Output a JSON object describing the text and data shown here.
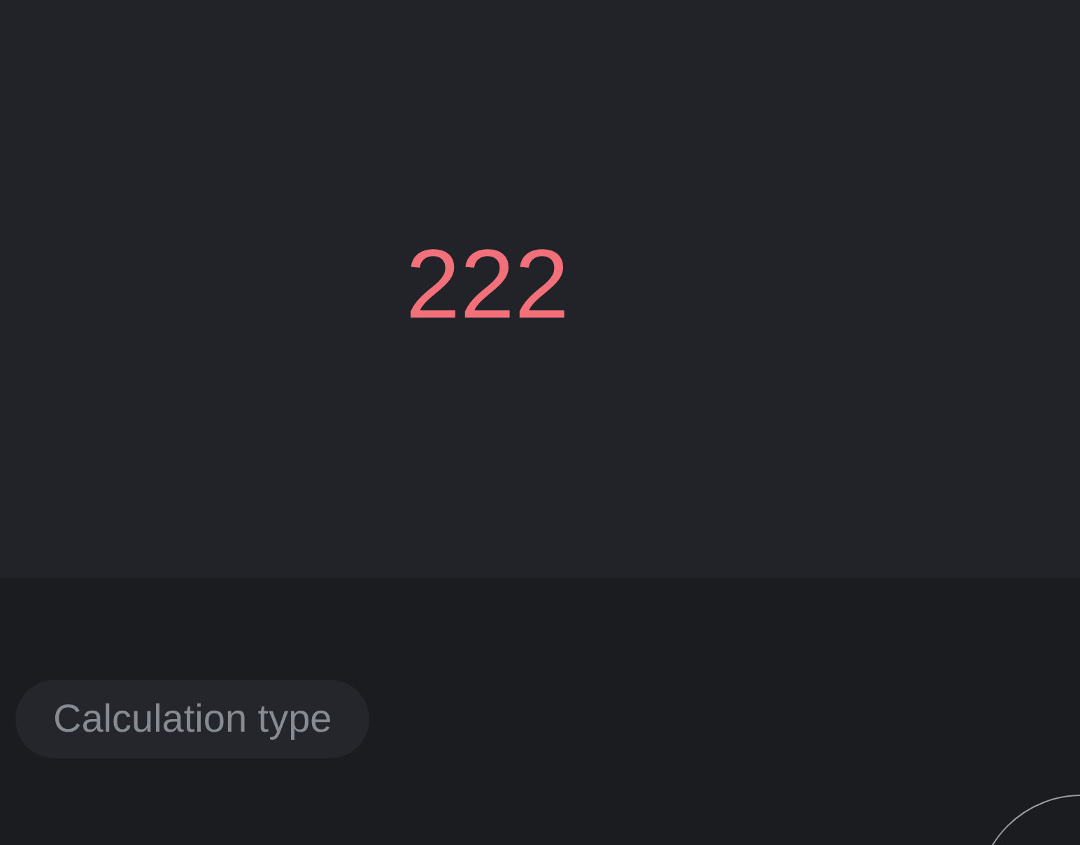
{
  "display": {
    "value": "222"
  },
  "calculation_type": {
    "label": "Calculation type"
  }
}
